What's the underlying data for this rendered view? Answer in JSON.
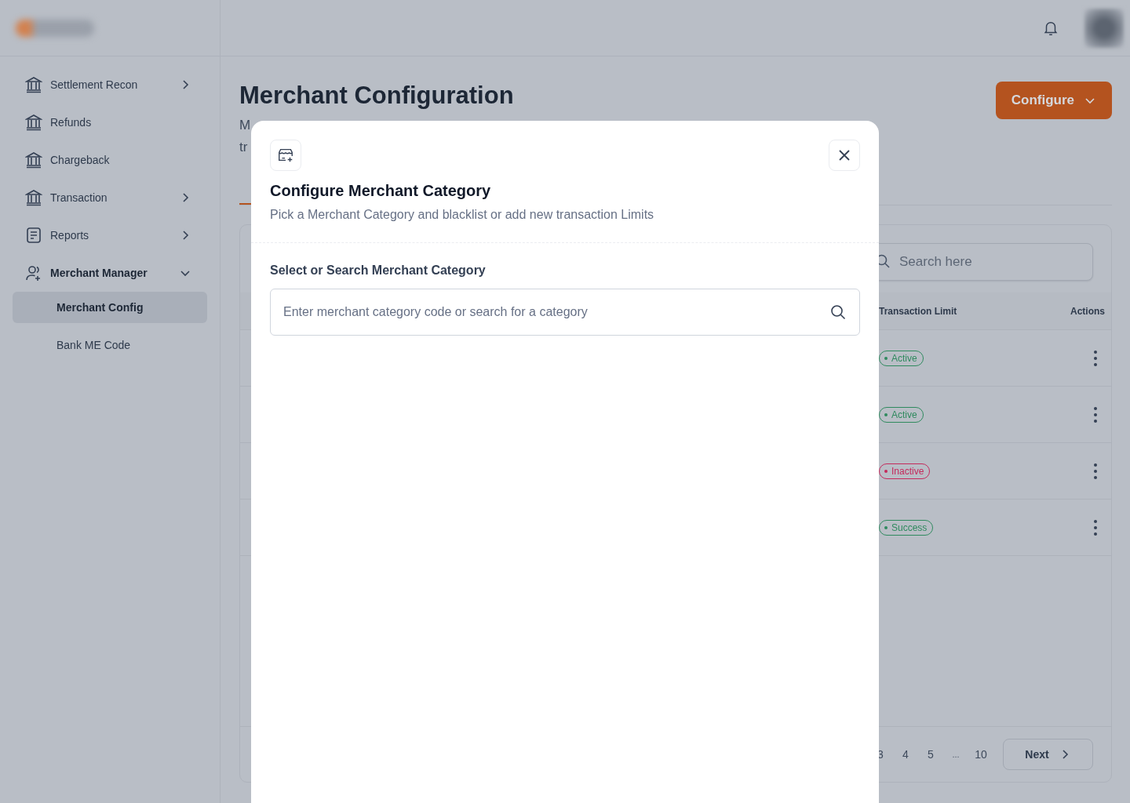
{
  "sidebar": {
    "items": [
      {
        "label": "Settlement Recon",
        "kind": "bank",
        "expandable": true,
        "expanded": false
      },
      {
        "label": "Refunds",
        "kind": "bank",
        "expandable": false,
        "expanded": false
      },
      {
        "label": "Chargeback",
        "kind": "bank",
        "expandable": false,
        "expanded": false
      },
      {
        "label": "Transaction",
        "kind": "bank",
        "expandable": true,
        "expanded": false
      },
      {
        "label": "Reports",
        "kind": "document",
        "expandable": true,
        "expanded": false
      },
      {
        "label": "Merchant Manager",
        "kind": "users",
        "expandable": true,
        "expanded": true,
        "children": [
          {
            "label": "Merchant Config",
            "selected": true
          },
          {
            "label": "Bank ME Code",
            "selected": false
          }
        ]
      }
    ]
  },
  "page": {
    "title": "Merchant Configuration",
    "description_fragments": [
      "M",
      "tr"
    ],
    "configure_button": "Configure"
  },
  "table": {
    "search": {
      "placeholder": "Search here"
    },
    "columns": [
      "Transaction Limit",
      "Actions"
    ],
    "rows": [
      {
        "status": "Active",
        "color": "#2f8a5e"
      },
      {
        "status": "Active",
        "color": "#2f8a5e"
      },
      {
        "status": "Inactive",
        "color": "#c42a5c"
      },
      {
        "status": "Success",
        "color": "#2f8a5e"
      }
    ],
    "pagination": {
      "pages": [
        "3",
        "4",
        "5",
        "...",
        "10"
      ],
      "next": "Next"
    }
  },
  "modal": {
    "title": "Configure Merchant Category",
    "subtitle": "Pick a Merchant Category and blacklist or add new transaction Limits",
    "field_label": "Select or Search Merchant Category",
    "search": {
      "placeholder": "Enter merchant category code or search for a category"
    }
  }
}
